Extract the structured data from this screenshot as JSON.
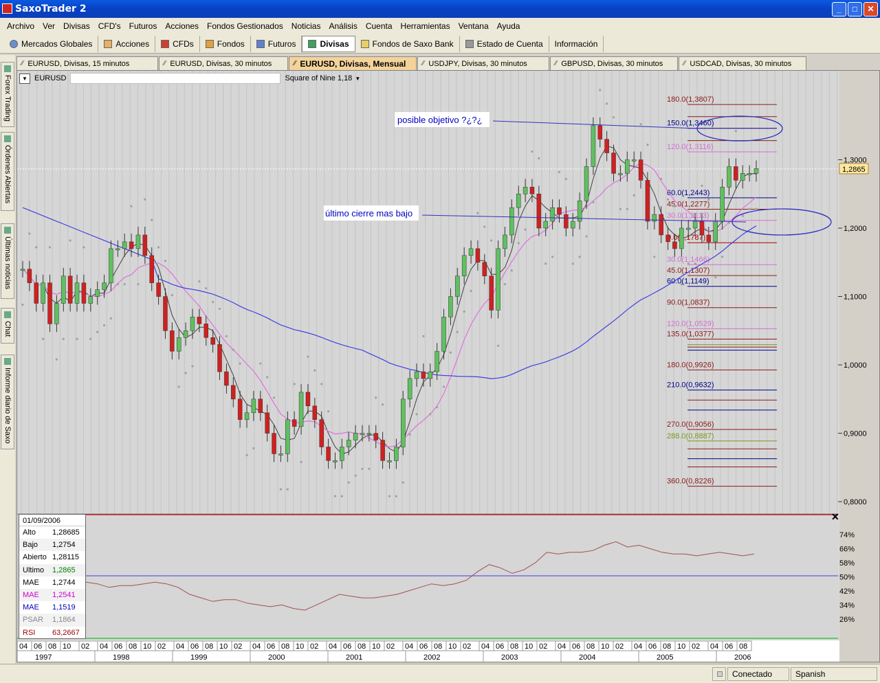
{
  "window": {
    "title": "SaxoTrader 2"
  },
  "menu": [
    "Archivo",
    "Ver",
    "Divisas",
    "CFD's",
    "Futuros",
    "Acciones",
    "Fondos Gestionados",
    "Noticias",
    "Análisis",
    "Cuenta",
    "Herramientas",
    "Ventana",
    "Ayuda"
  ],
  "toolbar": [
    "Mercados Globales",
    "Acciones",
    "CFDs",
    "Fondos",
    "Futuros",
    "Divisas",
    "Fondos de Saxo Bank",
    "Estado de Cuenta",
    "Información"
  ],
  "toolbar_active": "Divisas",
  "side_tabs": [
    "Forex Trading",
    "Órdenes Abiertas",
    "Últimas noticias",
    "Chat",
    "Informe diario de Saxo"
  ],
  "chart_tabs": [
    "EURUSD, Divisas, 15 minutos",
    "EURUSD, Divisas, 30 minutos",
    "EURUSD, Divisas, Mensual",
    "USDJPY, Divisas, 30 minutos",
    "GBPUSD, Divisas, 30 minutos",
    "USDCAD, Divisas, 30 minutos"
  ],
  "active_chart_tab": "EURUSD, Divisas, Mensual",
  "symbol": "EURUSD",
  "study": "Square of Nine 1,18",
  "annotations": {
    "target": "posible objetivo ?¿?¿",
    "low": "último cierre mas bajo"
  },
  "sq9_levels": [
    {
      "label": "180.0(1,3807)",
      "value": 1.3807,
      "color": "#8b1a1a"
    },
    {
      "label": "150.0(1,3460)",
      "value": 1.346,
      "color": "#00008b"
    },
    {
      "label": "120.0(1,3116)",
      "value": 1.3116,
      "color": "#d070d0"
    },
    {
      "label": "60.0(1,2443)",
      "value": 1.2443,
      "color": "#00008b"
    },
    {
      "label": "45.0(1,2277)",
      "value": 1.2277,
      "color": "#8b1a1a"
    },
    {
      "label": "30.0(1,2113)",
      "value": 1.2113,
      "color": "#d070d0"
    },
    {
      "label": "0.0(1,1787)",
      "value": 1.1787,
      "color": "#b00000"
    },
    {
      "label": "30.0(1,1466)",
      "value": 1.1466,
      "color": "#d070d0"
    },
    {
      "label": "45.0(1,1307)",
      "value": 1.1307,
      "color": "#8b1a1a"
    },
    {
      "label": "60.0(1,1149)",
      "value": 1.1149,
      "color": "#00008b"
    },
    {
      "label": "90.0(1,0837)",
      "value": 1.0837,
      "color": "#8b1a1a"
    },
    {
      "label": "120.0(1,0529)",
      "value": 1.0529,
      "color": "#d070d0"
    },
    {
      "label": "135.0(1,0377)",
      "value": 1.0377,
      "color": "#8b1a1a"
    },
    {
      "label": "180.0(0,9926)",
      "value": 0.9926,
      "color": "#8b1a1a"
    },
    {
      "label": "210.0(0,9632)",
      "value": 0.9632,
      "color": "#00008b"
    },
    {
      "label": "270.0(0,9056)",
      "value": 0.9056,
      "color": "#8b1a1a"
    },
    {
      "label": "288.0(0,8887)",
      "value": 0.8887,
      "color": "#7a9a20"
    },
    {
      "label": "360.0(0,8226)",
      "value": 0.8226,
      "color": "#8b1a1a"
    }
  ],
  "extra_lines": [
    {
      "value": 1.363,
      "color": "#8b1a1a"
    },
    {
      "value": 1.328,
      "color": "#8b1a1a"
    },
    {
      "value": 1.026,
      "color": "#8b1a1a"
    },
    {
      "value": 1.0295,
      "color": "#7a9a20"
    },
    {
      "value": 1.0215,
      "color": "#00008b"
    },
    {
      "value": 0.9485,
      "color": "#8b1a1a"
    },
    {
      "value": 0.934,
      "color": "#00008b"
    },
    {
      "value": 0.8772,
      "color": "#8b1a1a"
    },
    {
      "value": 0.8627,
      "color": "#00008b"
    },
    {
      "value": 0.8508,
      "color": "#8b1a1a"
    }
  ],
  "price_axis": {
    "ticks": [
      "1,3000",
      "1,2000",
      "1,1000",
      "1,0000",
      "0,9000",
      "0,8000"
    ],
    "last_price": "1,2865"
  },
  "rsi_axis": {
    "ticks": [
      "74%",
      "66%",
      "58%",
      "50%",
      "42%",
      "34%",
      "26%"
    ]
  },
  "time_axis": {
    "months": [
      "04",
      "06",
      "08",
      "10",
      "02",
      "04",
      "06",
      "08",
      "10",
      "02",
      "04",
      "06",
      "08",
      "10",
      "02",
      "04",
      "06",
      "08",
      "10",
      "02",
      "04",
      "06",
      "08",
      "10",
      "02",
      "04",
      "06",
      "08",
      "10",
      "02",
      "04",
      "06",
      "08",
      "10",
      "02",
      "04",
      "06",
      "08",
      "10",
      "02",
      "04",
      "06",
      "08",
      "10",
      "02",
      "04",
      "06",
      "08"
    ],
    "years": [
      "1997",
      "1998",
      "1999",
      "2000",
      "2001",
      "2002",
      "2003",
      "2004",
      "2005",
      "2006"
    ]
  },
  "infobox": {
    "date": "01/09/2006",
    "rows": [
      {
        "label": "Alto",
        "value": "1,28685",
        "color": "#000000"
      },
      {
        "label": "Bajo",
        "value": "1,2754",
        "color": "#000000"
      },
      {
        "label": "Abierto",
        "value": "1,28115",
        "color": "#000000"
      },
      {
        "label": "Ultimo",
        "value": "1,2865",
        "color": "#008000"
      },
      {
        "label": "MAE",
        "value": "1,2744",
        "color": "#000000"
      },
      {
        "label": "MAE",
        "value": "1,2541",
        "color": "#d000d0"
      },
      {
        "label": "MAE",
        "value": "1,1519",
        "color": "#0000c0"
      },
      {
        "label": "PSAR",
        "value": "1,1864",
        "color": "#888888"
      },
      {
        "label": "RSI",
        "value": "63,2667",
        "color": "#a00000"
      }
    ]
  },
  "status": {
    "connection": "Conectado",
    "language": "Spanish"
  },
  "chart_data": {
    "type": "candlestick",
    "title": "EURUSD",
    "ylim": [
      0.785,
      1.405
    ],
    "series": [
      {
        "name": "EURUSD",
        "note": "monthly candles approximated (close)",
        "values": [
          1.14,
          1.12,
          1.09,
          1.12,
          1.06,
          1.09,
          1.13,
          1.09,
          1.12,
          1.09,
          1.1,
          1.11,
          1.12,
          1.17,
          1.17,
          1.18,
          1.17,
          1.19,
          1.16,
          1.12,
          1.1,
          1.05,
          1.02,
          1.04,
          1.05,
          1.07,
          1.06,
          1.04,
          1.03,
          0.99,
          0.97,
          0.95,
          0.92,
          0.93,
          0.95,
          0.93,
          0.9,
          0.87,
          0.87,
          0.92,
          0.91,
          0.96,
          0.94,
          0.92,
          0.88,
          0.86,
          0.86,
          0.88,
          0.89,
          0.9,
          0.9,
          0.9,
          0.89,
          0.86,
          0.86,
          0.88,
          0.95,
          0.98,
          0.99,
          0.98,
          0.99,
          1.02,
          1.07,
          1.1,
          1.13,
          1.16,
          1.17,
          1.15,
          1.13,
          1.08,
          1.17,
          1.19,
          1.23,
          1.25,
          1.26,
          1.25,
          1.2,
          1.21,
          1.23,
          1.22,
          1.2,
          1.21,
          1.24,
          1.29,
          1.35,
          1.33,
          1.31,
          1.28,
          1.28,
          1.3,
          1.3,
          1.27,
          1.21,
          1.22,
          1.19,
          1.18,
          1.17,
          1.2,
          1.2,
          1.21,
          1.19,
          1.18,
          1.21,
          1.26,
          1.29,
          1.27,
          1.28,
          1.28,
          1.287
        ]
      },
      {
        "name": "RSI",
        "values": [
          47,
          46,
          44,
          45,
          45,
          46,
          47,
          46,
          44,
          40,
          38,
          36,
          37,
          37,
          35,
          34,
          33,
          34,
          32,
          31,
          34,
          37,
          40,
          39,
          38,
          38,
          39,
          40,
          42,
          44,
          46,
          45,
          46,
          48,
          53,
          57,
          55,
          52,
          54,
          58,
          64,
          63,
          64,
          64,
          65,
          68,
          70,
          67,
          68,
          66,
          64,
          63,
          63,
          62,
          63,
          64,
          63,
          62,
          63
        ]
      }
    ]
  }
}
